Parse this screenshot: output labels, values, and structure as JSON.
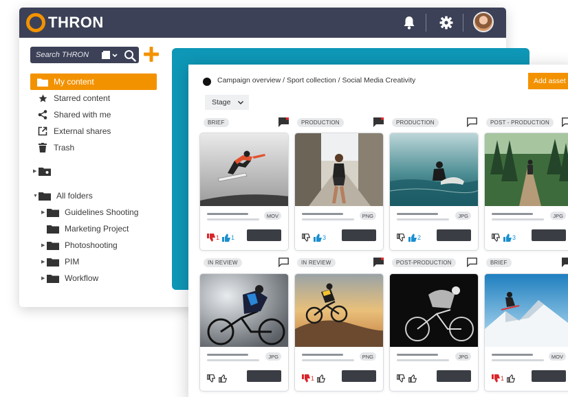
{
  "app": {
    "name": "THRON"
  },
  "colors": {
    "brand_orange": "#f39200",
    "navy": "#3c4157",
    "teal": "#0e97b7",
    "like_blue": "#1a8fd0",
    "dislike_red": "#d9262b"
  },
  "header": {
    "icons": [
      "bell-icon",
      "gear-icon",
      "avatar"
    ]
  },
  "search": {
    "placeholder": "Search THRON"
  },
  "nav": {
    "items": [
      {
        "label": "My content",
        "icon": "folder-icon",
        "active": true
      },
      {
        "label": "Starred content",
        "icon": "star-icon"
      },
      {
        "label": "Shared with me",
        "icon": "share-icon"
      },
      {
        "label": "External shares",
        "icon": "external-link-icon"
      },
      {
        "label": "Trash",
        "icon": "trash-icon"
      }
    ]
  },
  "tree": {
    "all_folders": "All folders",
    "children": [
      "Guidelines Shooting",
      "Marketing Project",
      "Photoshooting",
      "PIM",
      "Workflow"
    ]
  },
  "main": {
    "breadcrumb": "Campaign overview / Sport collection / Social Media Creativity",
    "add_asset_label": "Add asset",
    "filter_label": "Stage"
  },
  "cards": [
    {
      "tag": "BRIEF",
      "comment_unread": true,
      "type": "MOV",
      "dislikes": "1",
      "likes": "1",
      "thumb": "snowboard"
    },
    {
      "tag": "PRODUCTION",
      "comment_unread": true,
      "type": "PNG",
      "dislikes": "",
      "likes": "3",
      "thumb": "runner"
    },
    {
      "tag": "PRODUCTION",
      "comment_unread": false,
      "type": "JPG",
      "dislikes": "",
      "likes": "2",
      "thumb": "surfer"
    },
    {
      "tag": "POST - PRODUCTION",
      "comment_unread": false,
      "type": "JPG",
      "dislikes": "",
      "likes": "3",
      "thumb": "hiker"
    },
    {
      "tag": "IN REVIEW",
      "comment_unread": false,
      "type": "JPG",
      "dislikes": "",
      "likes": "",
      "thumb": "cyclist"
    },
    {
      "tag": "IN REVIEW",
      "comment_unread": true,
      "type": "PNG",
      "dislikes": "1",
      "likes": "",
      "thumb": "mtb"
    },
    {
      "tag": "POST-PRODUCTION",
      "comment_unread": false,
      "type": "JPG",
      "dislikes": "",
      "likes": "",
      "thumb": "track-cyclist"
    },
    {
      "tag": "BRIEF",
      "comment_unread": true,
      "type": "MOV",
      "dislikes": "1",
      "likes": "",
      "thumb": "ski"
    }
  ]
}
